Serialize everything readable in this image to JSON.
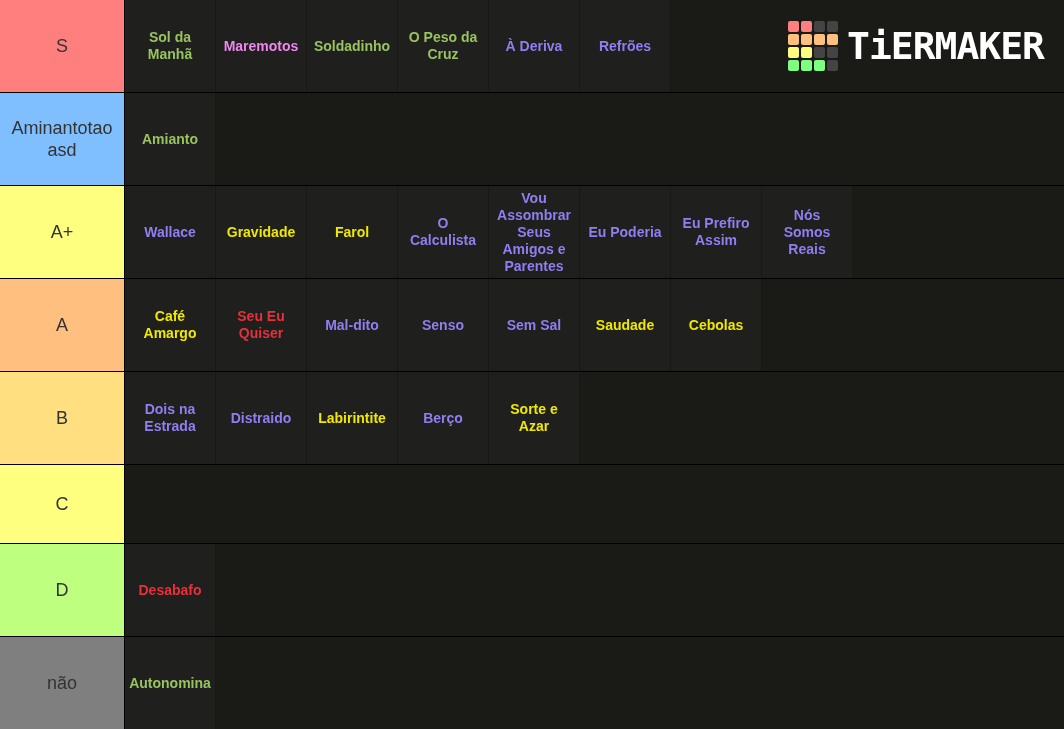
{
  "logo": {
    "text": "TiERMAKER"
  },
  "tiers": [
    {
      "label": "S",
      "color": "#ff7f7f",
      "items": [
        {
          "text": "Sol da Manhã",
          "color": "#98c35f"
        },
        {
          "text": "Maremotos",
          "color": "#ee88ee"
        },
        {
          "text": "Soldadinho",
          "color": "#98c35f"
        },
        {
          "text": "O Peso da Cruz",
          "color": "#98c35f"
        },
        {
          "text": "À Deriva",
          "color": "#8f7ff0"
        },
        {
          "text": "Refrões",
          "color": "#8f7ff0"
        }
      ]
    },
    {
      "label": "Aminantotao asd",
      "color": "#7fbfff",
      "items": [
        {
          "text": "Amianto",
          "color": "#98c35f"
        }
      ]
    },
    {
      "label": "A+",
      "color": "#ffff7f",
      "items": [
        {
          "text": "Wallace",
          "color": "#8f7ff0"
        },
        {
          "text": "Gravidade",
          "color": "#f0e800"
        },
        {
          "text": "Farol",
          "color": "#f0e800"
        },
        {
          "text": "O Calculista",
          "color": "#8f7ff0"
        },
        {
          "text": "Vou Assombrar Seus Amigos e Parentes",
          "color": "#8f7ff0"
        },
        {
          "text": "Eu Poderia",
          "color": "#8f7ff0"
        },
        {
          "text": "Eu Prefiro Assim",
          "color": "#8f7ff0"
        },
        {
          "text": "Nós Somos Reais",
          "color": "#8f7ff0"
        }
      ]
    },
    {
      "label": "A",
      "color": "#ffbf7f",
      "items": [
        {
          "text": "Café Amargo",
          "color": "#f0e800"
        },
        {
          "text": "Seu Eu Quiser",
          "color": "#e8303a"
        },
        {
          "text": "Mal-dito",
          "color": "#8f7ff0"
        },
        {
          "text": "Senso",
          "color": "#8f7ff0"
        },
        {
          "text": "Sem Sal",
          "color": "#8f7ff0"
        },
        {
          "text": "Saudade",
          "color": "#f0e800"
        },
        {
          "text": "Cebolas",
          "color": "#f0e800"
        }
      ]
    },
    {
      "label": "B",
      "color": "#ffdf7f",
      "items": [
        {
          "text": "Dois na Estrada",
          "color": "#8f7ff0"
        },
        {
          "text": "Distraido",
          "color": "#8f7ff0"
        },
        {
          "text": "Labirintite",
          "color": "#f0e800"
        },
        {
          "text": "Berço",
          "color": "#8f7ff0"
        },
        {
          "text": "Sorte e Azar",
          "color": "#f0e800"
        }
      ]
    },
    {
      "label": "C",
      "color": "#ffff7f"
    },
    {
      "label": "D",
      "color": "#bfff7f",
      "items": [
        {
          "text": "Desabafo",
          "color": "#e8303a"
        }
      ]
    },
    {
      "label": "não",
      "color": "#7f7f7f",
      "items": [
        {
          "text": "Autonomina",
          "color": "#98c35f"
        }
      ]
    }
  ]
}
